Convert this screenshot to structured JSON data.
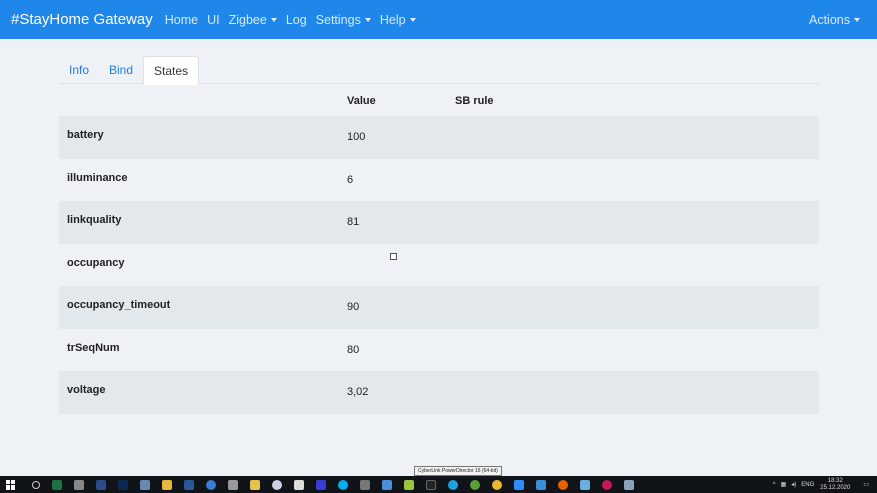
{
  "navbar": {
    "brand": "#StayHome Gateway",
    "items": [
      {
        "label": "Home",
        "dropdown": false
      },
      {
        "label": "UI",
        "dropdown": false
      },
      {
        "label": "Zigbee",
        "dropdown": true
      },
      {
        "label": "Log",
        "dropdown": false
      },
      {
        "label": "Settings",
        "dropdown": true
      },
      {
        "label": "Help",
        "dropdown": true
      }
    ],
    "actions_label": "Actions",
    "color": "#1f86ea"
  },
  "tabs": [
    {
      "label": "Info",
      "active": false
    },
    {
      "label": "Bind",
      "active": false
    },
    {
      "label": "States",
      "active": true
    }
  ],
  "table": {
    "columns": [
      "Value",
      "SB rule"
    ],
    "rows": [
      {
        "name": "battery",
        "value": "100"
      },
      {
        "name": "illuminance",
        "value": "6"
      },
      {
        "name": "linkquality",
        "value": "81"
      },
      {
        "name": "occupancy",
        "value": "",
        "checkbox": true
      },
      {
        "name": "occupancy_timeout",
        "value": "90"
      },
      {
        "name": "trSeqNum",
        "value": "80"
      },
      {
        "name": "voltage",
        "value": "3,02"
      }
    ]
  },
  "taskbar": {
    "tooltip": "CyberLink PowerDirector 16 (64-bit)",
    "language": "ENG",
    "time": "18:32",
    "date": "25.12.2020"
  }
}
